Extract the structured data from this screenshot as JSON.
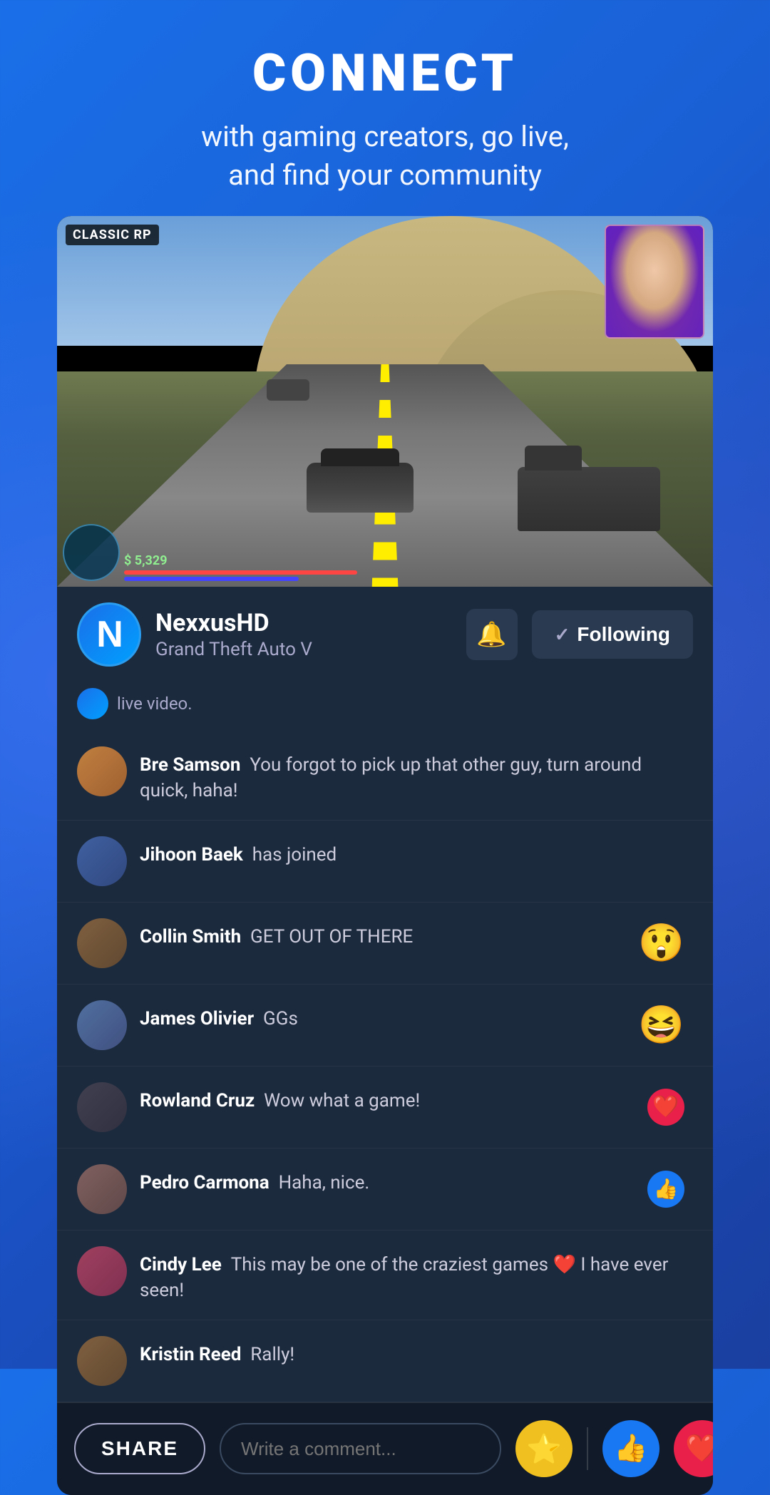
{
  "header": {
    "title": "CONNECT",
    "subtitle": "with gaming creators, go live,\nand find your community"
  },
  "video": {
    "game_tag": "CLASSIC RP",
    "streamer_cam_visible": true
  },
  "streamer": {
    "name": "NexxusHD",
    "game": "Grand Theft Auto V",
    "avatar_letter": "N"
  },
  "buttons": {
    "bell_label": "🔔",
    "following_label": "Following",
    "check_mark": "✓"
  },
  "live_notice": {
    "text": "live video."
  },
  "comments": [
    {
      "username": "Bre Samson",
      "text": "You forgot to pick up that other guy, turn around quick, haha!",
      "reaction": null
    },
    {
      "username": "Jihoon Baek",
      "text": "has joined",
      "reaction": null
    },
    {
      "username": "Collin Smith",
      "text": "GET OUT OF THERE",
      "reaction": "😲"
    },
    {
      "username": "James Olivier",
      "text": "GGs",
      "reaction": "😆"
    },
    {
      "username": "Rowland Cruz",
      "text": "Wow what a game!",
      "reaction": "heart"
    },
    {
      "username": "Pedro Carmona",
      "text": "Haha, nice.",
      "reaction": "like"
    },
    {
      "username": "Cindy Lee",
      "text": "This may be one of the craziest games ❤️ I have ever seen!",
      "reaction": null
    },
    {
      "username": "Kristin Reed",
      "text": "Rally!",
      "reaction": null
    }
  ],
  "bottom_bar": {
    "share_label": "SHARE",
    "comment_placeholder": "Write a comment...",
    "star_icon": "⭐",
    "like_icon": "👍"
  }
}
